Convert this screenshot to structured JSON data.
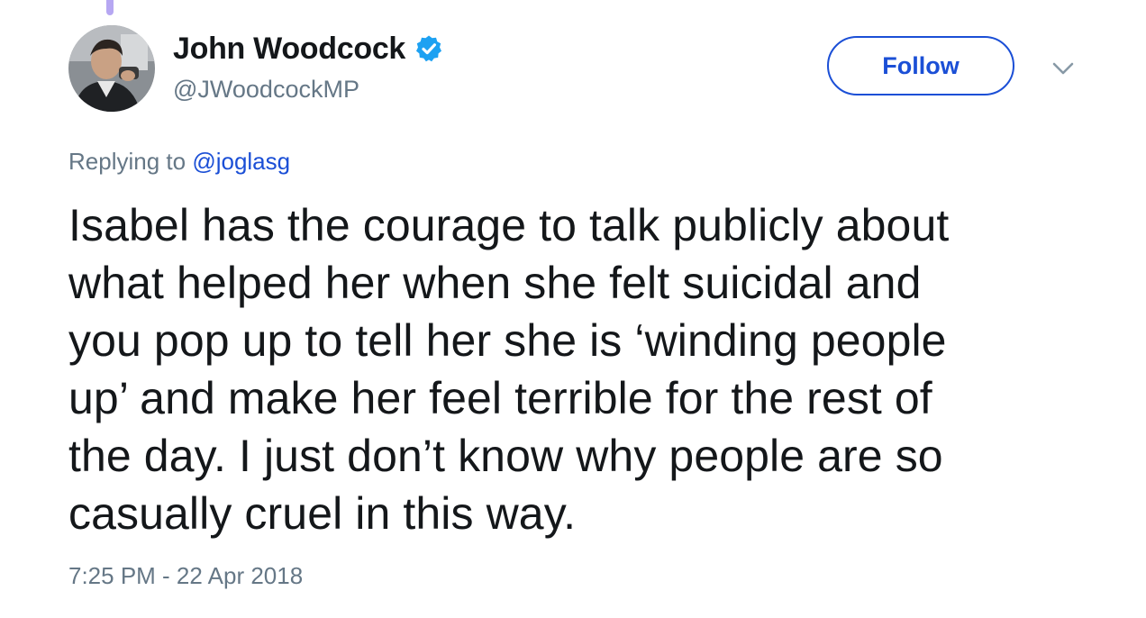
{
  "tweet": {
    "author": {
      "display_name": "John Woodcock",
      "handle": "@JWoodcockMP",
      "verified": true,
      "avatar_icon": "profile-photo"
    },
    "follow_label": "Follow",
    "menu_icon": "chevron-down-icon",
    "reply": {
      "prefix": "Replying to ",
      "handle": "@joglasg"
    },
    "text_lines": [
      "Isabel has the courage to talk publicly about",
      "what helped her when she felt suicidal and",
      "you pop up to tell her she is ‘winding people",
      "up’ and make her feel terrible for the rest of",
      "the day. I just don’t know why people are so",
      "casually cruel in this way."
    ],
    "timestamp": "7:25 PM - 22 Apr 2018"
  },
  "colors": {
    "link_blue": "#1b4fd6",
    "verified_blue": "#1da1f2",
    "secondary_text": "#657786",
    "primary_text": "#14171a",
    "thread_line": "#b6a7f2"
  }
}
